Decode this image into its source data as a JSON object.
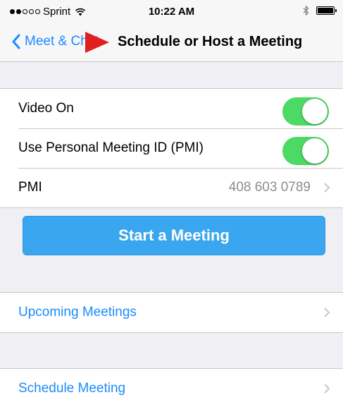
{
  "status_bar": {
    "carrier": "Sprint",
    "time": "10:22 AM"
  },
  "nav": {
    "back_label": "Meet & Chat",
    "title": "Schedule or Host a Meeting"
  },
  "settings": {
    "video_on_label": "Video On",
    "video_on": true,
    "pmi_toggle_label": "Use Personal Meeting ID (PMI)",
    "pmi_toggle": true,
    "pmi_label": "PMI",
    "pmi_value": "408 603 0789"
  },
  "start_button_label": "Start a Meeting",
  "upcoming_label": "Upcoming Meetings",
  "schedule_label": "Schedule Meeting",
  "colors": {
    "accent": "#1a8cff",
    "toggle_on": "#4cd964",
    "button": "#3aa6f0",
    "overlay": "#e0201c"
  }
}
